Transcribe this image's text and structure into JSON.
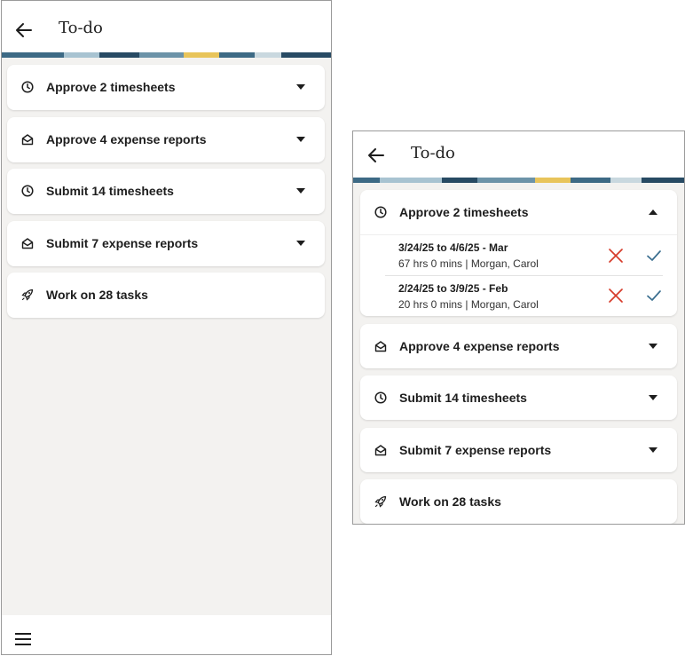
{
  "colors": {
    "background": "#f3f2f0",
    "reject": "#d63b2a",
    "approve": "#3a6e8f",
    "band": [
      "#6c93a8",
      "#274a63",
      "#a8c3d1",
      "#e8c45a",
      "#3d6a85",
      "#c9d8df"
    ]
  },
  "left_screen": {
    "title": "To-do",
    "cards": [
      {
        "label": "Approve 2 timesheets",
        "icon": "clock-icon"
      },
      {
        "label": "Approve 4 expense reports",
        "icon": "envelope-icon"
      },
      {
        "label": "Submit 14 timesheets",
        "icon": "clock-icon"
      },
      {
        "label": "Submit 7 expense reports",
        "icon": "envelope-icon"
      },
      {
        "label": "Work on 28 tasks",
        "icon": "rocket-icon"
      }
    ]
  },
  "right_screen": {
    "title": "To-do",
    "expanded_card": {
      "label": "Approve 2 timesheets",
      "icon": "clock-icon",
      "rows": [
        {
          "period": "3/24/25 to 4/6/25 - Mar",
          "detail": "67 hrs 0 mins | Morgan, Carol"
        },
        {
          "period": "2/24/25 to 3/9/25 - Feb",
          "detail": "20 hrs 0 mins | Morgan, Carol"
        }
      ]
    },
    "cards": [
      {
        "label": "Approve 4 expense reports",
        "icon": "envelope-icon"
      },
      {
        "label": "Submit 14 timesheets",
        "icon": "clock-icon"
      },
      {
        "label": "Submit 7 expense reports",
        "icon": "envelope-icon"
      },
      {
        "label": "Work on 28 tasks",
        "icon": "rocket-icon"
      }
    ]
  }
}
